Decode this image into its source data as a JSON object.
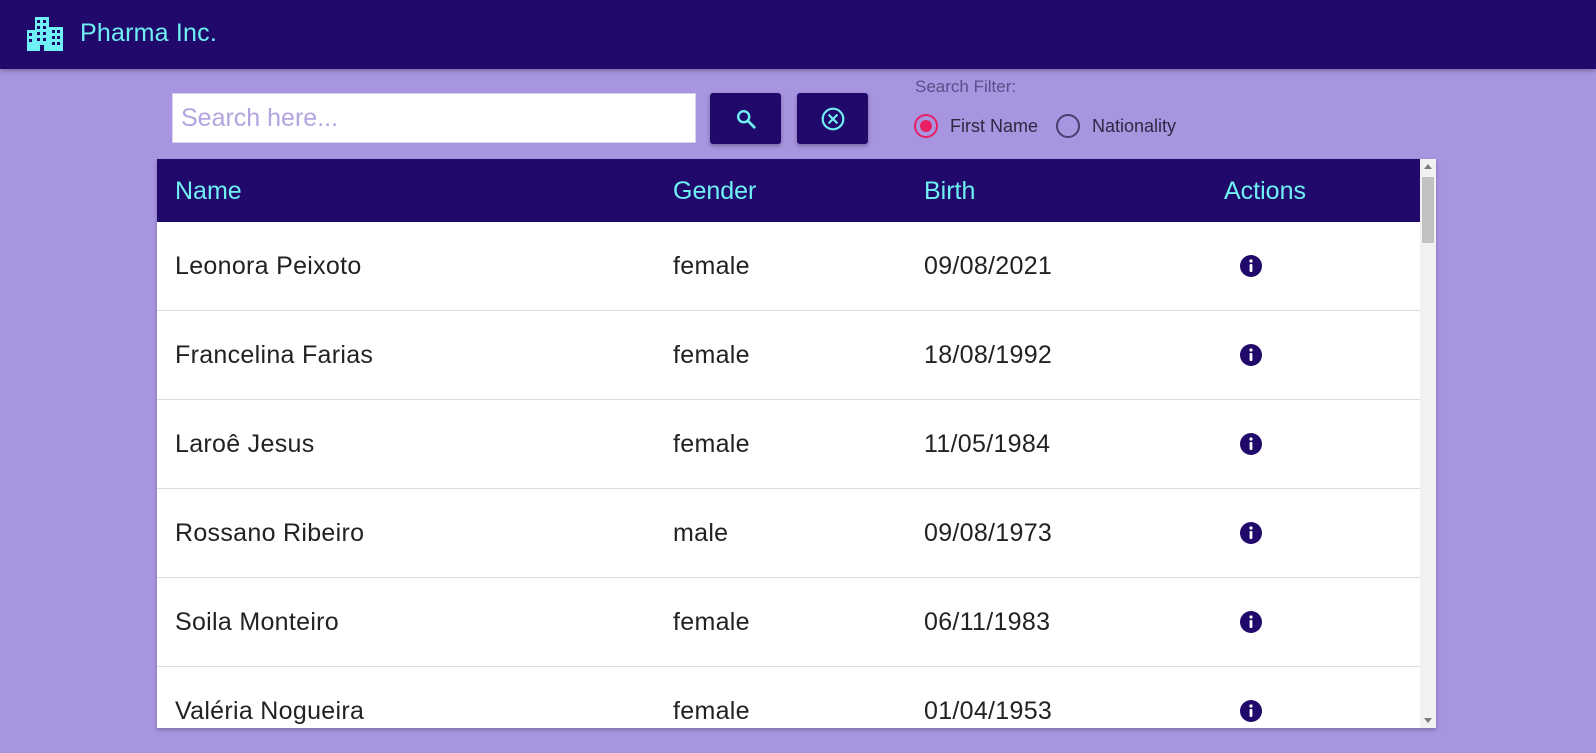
{
  "appbar": {
    "title": "Pharma Inc.",
    "logo_icon": "building-icon",
    "bg_color": "#21096b",
    "title_color": "#6ff0f4"
  },
  "search": {
    "placeholder": "Search here...",
    "value": "",
    "search_button_icon": "magnifier-icon",
    "clear_button_icon": "circle-x-icon"
  },
  "filter": {
    "label": "Search Filter:",
    "options": [
      {
        "label": "First Name",
        "checked": true
      },
      {
        "label": "Nationality",
        "checked": false
      }
    ],
    "selected_color": "#e91e63"
  },
  "table": {
    "headers": {
      "name": "Name",
      "gender": "Gender",
      "birth": "Birth",
      "actions": "Actions"
    },
    "rows": [
      {
        "name": "Leonora Peixoto",
        "gender": "female",
        "birth": "09/08/2021"
      },
      {
        "name": "Francelina Farias",
        "gender": "female",
        "birth": "18/08/1992"
      },
      {
        "name": "Laroê Jesus",
        "gender": "female",
        "birth": "11/05/1984"
      },
      {
        "name": "Rossano Ribeiro",
        "gender": "male",
        "birth": "09/08/1973"
      },
      {
        "name": "Soila Monteiro",
        "gender": "female",
        "birth": "06/11/1983"
      },
      {
        "name": "Valéria Nogueira",
        "gender": "female",
        "birth": "01/04/1953"
      }
    ],
    "action_icon": "info-circle-icon"
  },
  "background_color": "#a795e0"
}
